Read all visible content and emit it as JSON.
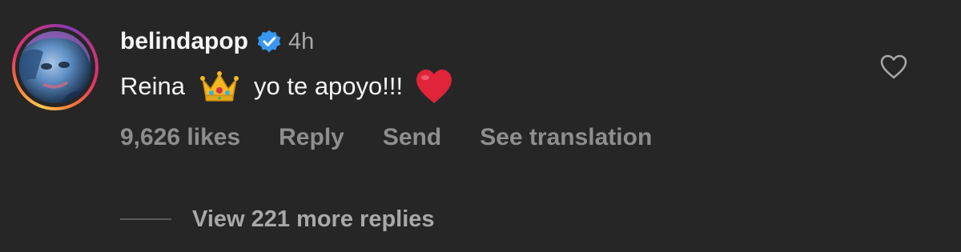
{
  "comment": {
    "username": "belindapop",
    "time": "4h",
    "message": {
      "before_crown": "Reina",
      "after_crown": "yo te apoyo!!!"
    },
    "likes": "9,626 likes",
    "reply_label": "Reply",
    "send_label": "Send",
    "translation_label": "See translation",
    "view_replies_label": "View 221 more replies"
  },
  "colors": {
    "background": "#262626",
    "primary_text": "#f5f5f5",
    "secondary_text": "#8e8e8e",
    "verified_blue": "#3897f0",
    "heart_red": "#e0243a"
  },
  "icons": {
    "verified": "verified-badge-icon",
    "crown": "crown-emoji-icon",
    "heart": "red-heart-emoji-icon",
    "like": "heart-outline-icon"
  }
}
